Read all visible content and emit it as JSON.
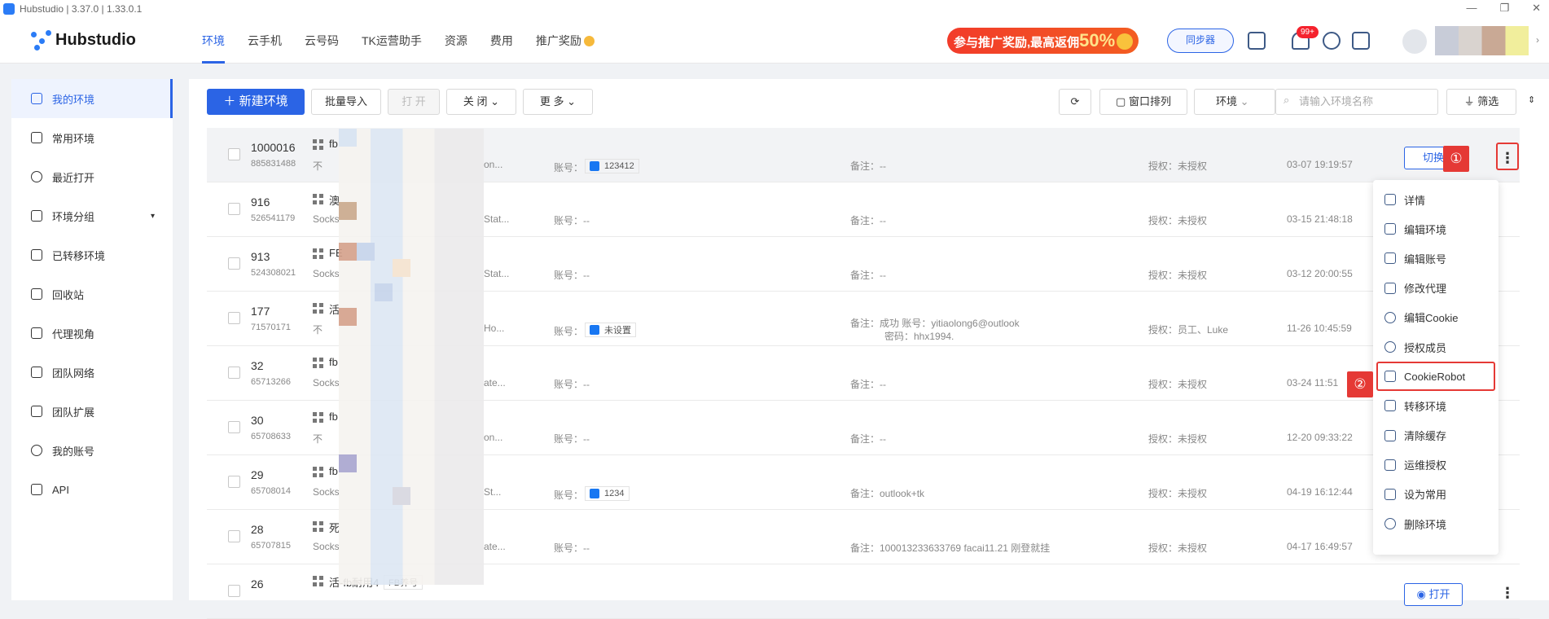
{
  "window": {
    "title": "Hubstudio | 3.37.0 | 1.33.0.1",
    "controls": [
      "—",
      "❐",
      "✕"
    ]
  },
  "brand": {
    "name": "Hubstudio"
  },
  "nav": {
    "tabs": [
      {
        "label": "环境"
      },
      {
        "label": "云手机"
      },
      {
        "label": "云号码"
      },
      {
        "label": "TK运营助手"
      },
      {
        "label": "资源"
      },
      {
        "label": "费用"
      },
      {
        "label": "推广奖励"
      }
    ],
    "promo": {
      "text": "参与推广奖励,最高返佣",
      "pct": "50%"
    },
    "sync_label": "同步器",
    "notif_count": "99+"
  },
  "sidebar": {
    "items": [
      {
        "label": "我的环境"
      },
      {
        "label": "常用环境"
      },
      {
        "label": "最近打开"
      },
      {
        "label": "环境分组"
      },
      {
        "label": "已转移环境"
      },
      {
        "label": "回收站"
      },
      {
        "label": "代理视角"
      },
      {
        "label": "团队网络"
      },
      {
        "label": "团队扩展"
      },
      {
        "label": "我的账号"
      },
      {
        "label": "API"
      }
    ]
  },
  "toolbar": {
    "new_env": "新建环境",
    "batch_import": "批量导入",
    "open": "打 开",
    "close": "关 闭",
    "more": "更 多",
    "window_arrange": "窗口排列",
    "env_select": "环境",
    "search_placeholder": "请输入环境名称",
    "filter": "筛选"
  },
  "rows": [
    {
      "id": "1000016",
      "sub": "885831488",
      "name": "fb",
      "proxy": "不",
      "ptrail": "on...",
      "acct_label": "账号：",
      "acct_value": "123412",
      "note": "备注：--",
      "note2": "",
      "auth": "授权：未授权",
      "date": "03-07 19:19:57",
      "op": "切换"
    },
    {
      "id": "916",
      "sub": "526541179",
      "name": "澳",
      "proxy": "Socks",
      "ptrail": "Stat...",
      "acct_label": "账号：--",
      "acct_value": "",
      "note": "备注：--",
      "note2": "",
      "auth": "授权：未授权",
      "date": "03-15 21:48:18",
      "op": ""
    },
    {
      "id": "913",
      "sub": "524308021",
      "name": "FE",
      "proxy": "Socks",
      "ptrail": "Stat...",
      "acct_label": "账号：--",
      "acct_value": "",
      "note": "备注：--",
      "note2": "",
      "auth": "授权：未授权",
      "date": "03-12 20:00:55",
      "op": ""
    },
    {
      "id": "177",
      "sub": "71570171",
      "name": "活",
      "proxy": "不",
      "ptrail": "Ho...",
      "acct_label": "账号：",
      "acct_value": "未设置",
      "note": "备注：成功 账号：yitiaolong6@outlook",
      "note2": "密码：hhx1994.",
      "auth": "授权：员工、Luke",
      "date": "11-26 10:45:59",
      "op": ""
    },
    {
      "id": "32",
      "sub": "65713266",
      "name": "fb",
      "proxy": "Socks",
      "ptrail": "ate...",
      "acct_label": "账号：--",
      "acct_value": "",
      "note": "备注：--",
      "note2": "",
      "auth": "授权：未授权",
      "date": "03-24 11:51",
      "op": ""
    },
    {
      "id": "30",
      "sub": "65708633",
      "name": "fb",
      "proxy": "不",
      "ptrail": "on...",
      "acct_label": "账号：--",
      "acct_value": "",
      "note": "备注：--",
      "note2": "",
      "auth": "授权：未授权",
      "date": "12-20 09:33:22",
      "op": ""
    },
    {
      "id": "29",
      "sub": "65708014",
      "name": "fb",
      "proxy": "Socks",
      "ptrail": "St...",
      "acct_label": "账号：",
      "acct_value": "1234",
      "note": "备注：outlook+tk",
      "note2": "",
      "auth": "授权：未授权",
      "date": "04-19 16:12:44",
      "op": ""
    },
    {
      "id": "28",
      "sub": "65707815",
      "name": "死",
      "proxy": "Socks",
      "ptrail": "ate...",
      "acct_label": "账号：--",
      "acct_value": "",
      "note": "备注：100013233633769 facai11.21 刚登就挂",
      "note2": "",
      "auth": "授权：未授权",
      "date": "04-17 16:49:57",
      "op": ""
    },
    {
      "id": "26",
      "sub": "",
      "name": "活-fb耐用4",
      "tag": "FB养号",
      "proxy": "",
      "ptrail": "",
      "acct_label": "",
      "acct_value": "",
      "note": "",
      "note2": "",
      "auth": "",
      "date": "",
      "op": "打开"
    }
  ],
  "dropdown": {
    "items": [
      {
        "label": "详情"
      },
      {
        "label": "编辑环境"
      },
      {
        "label": "编辑账号"
      },
      {
        "label": "修改代理"
      },
      {
        "label": "编辑Cookie"
      },
      {
        "label": "授权成员"
      },
      {
        "label": "CookieRobot"
      },
      {
        "label": "转移环境"
      },
      {
        "label": "清除缓存"
      },
      {
        "label": "运维授权"
      },
      {
        "label": "设为常用"
      },
      {
        "label": "删除环境"
      }
    ]
  },
  "callouts": {
    "one": "①",
    "two": "②"
  },
  "colors": {
    "primary": "#2b64e5",
    "callout": "#e53935",
    "promo": "#f23b2a"
  }
}
